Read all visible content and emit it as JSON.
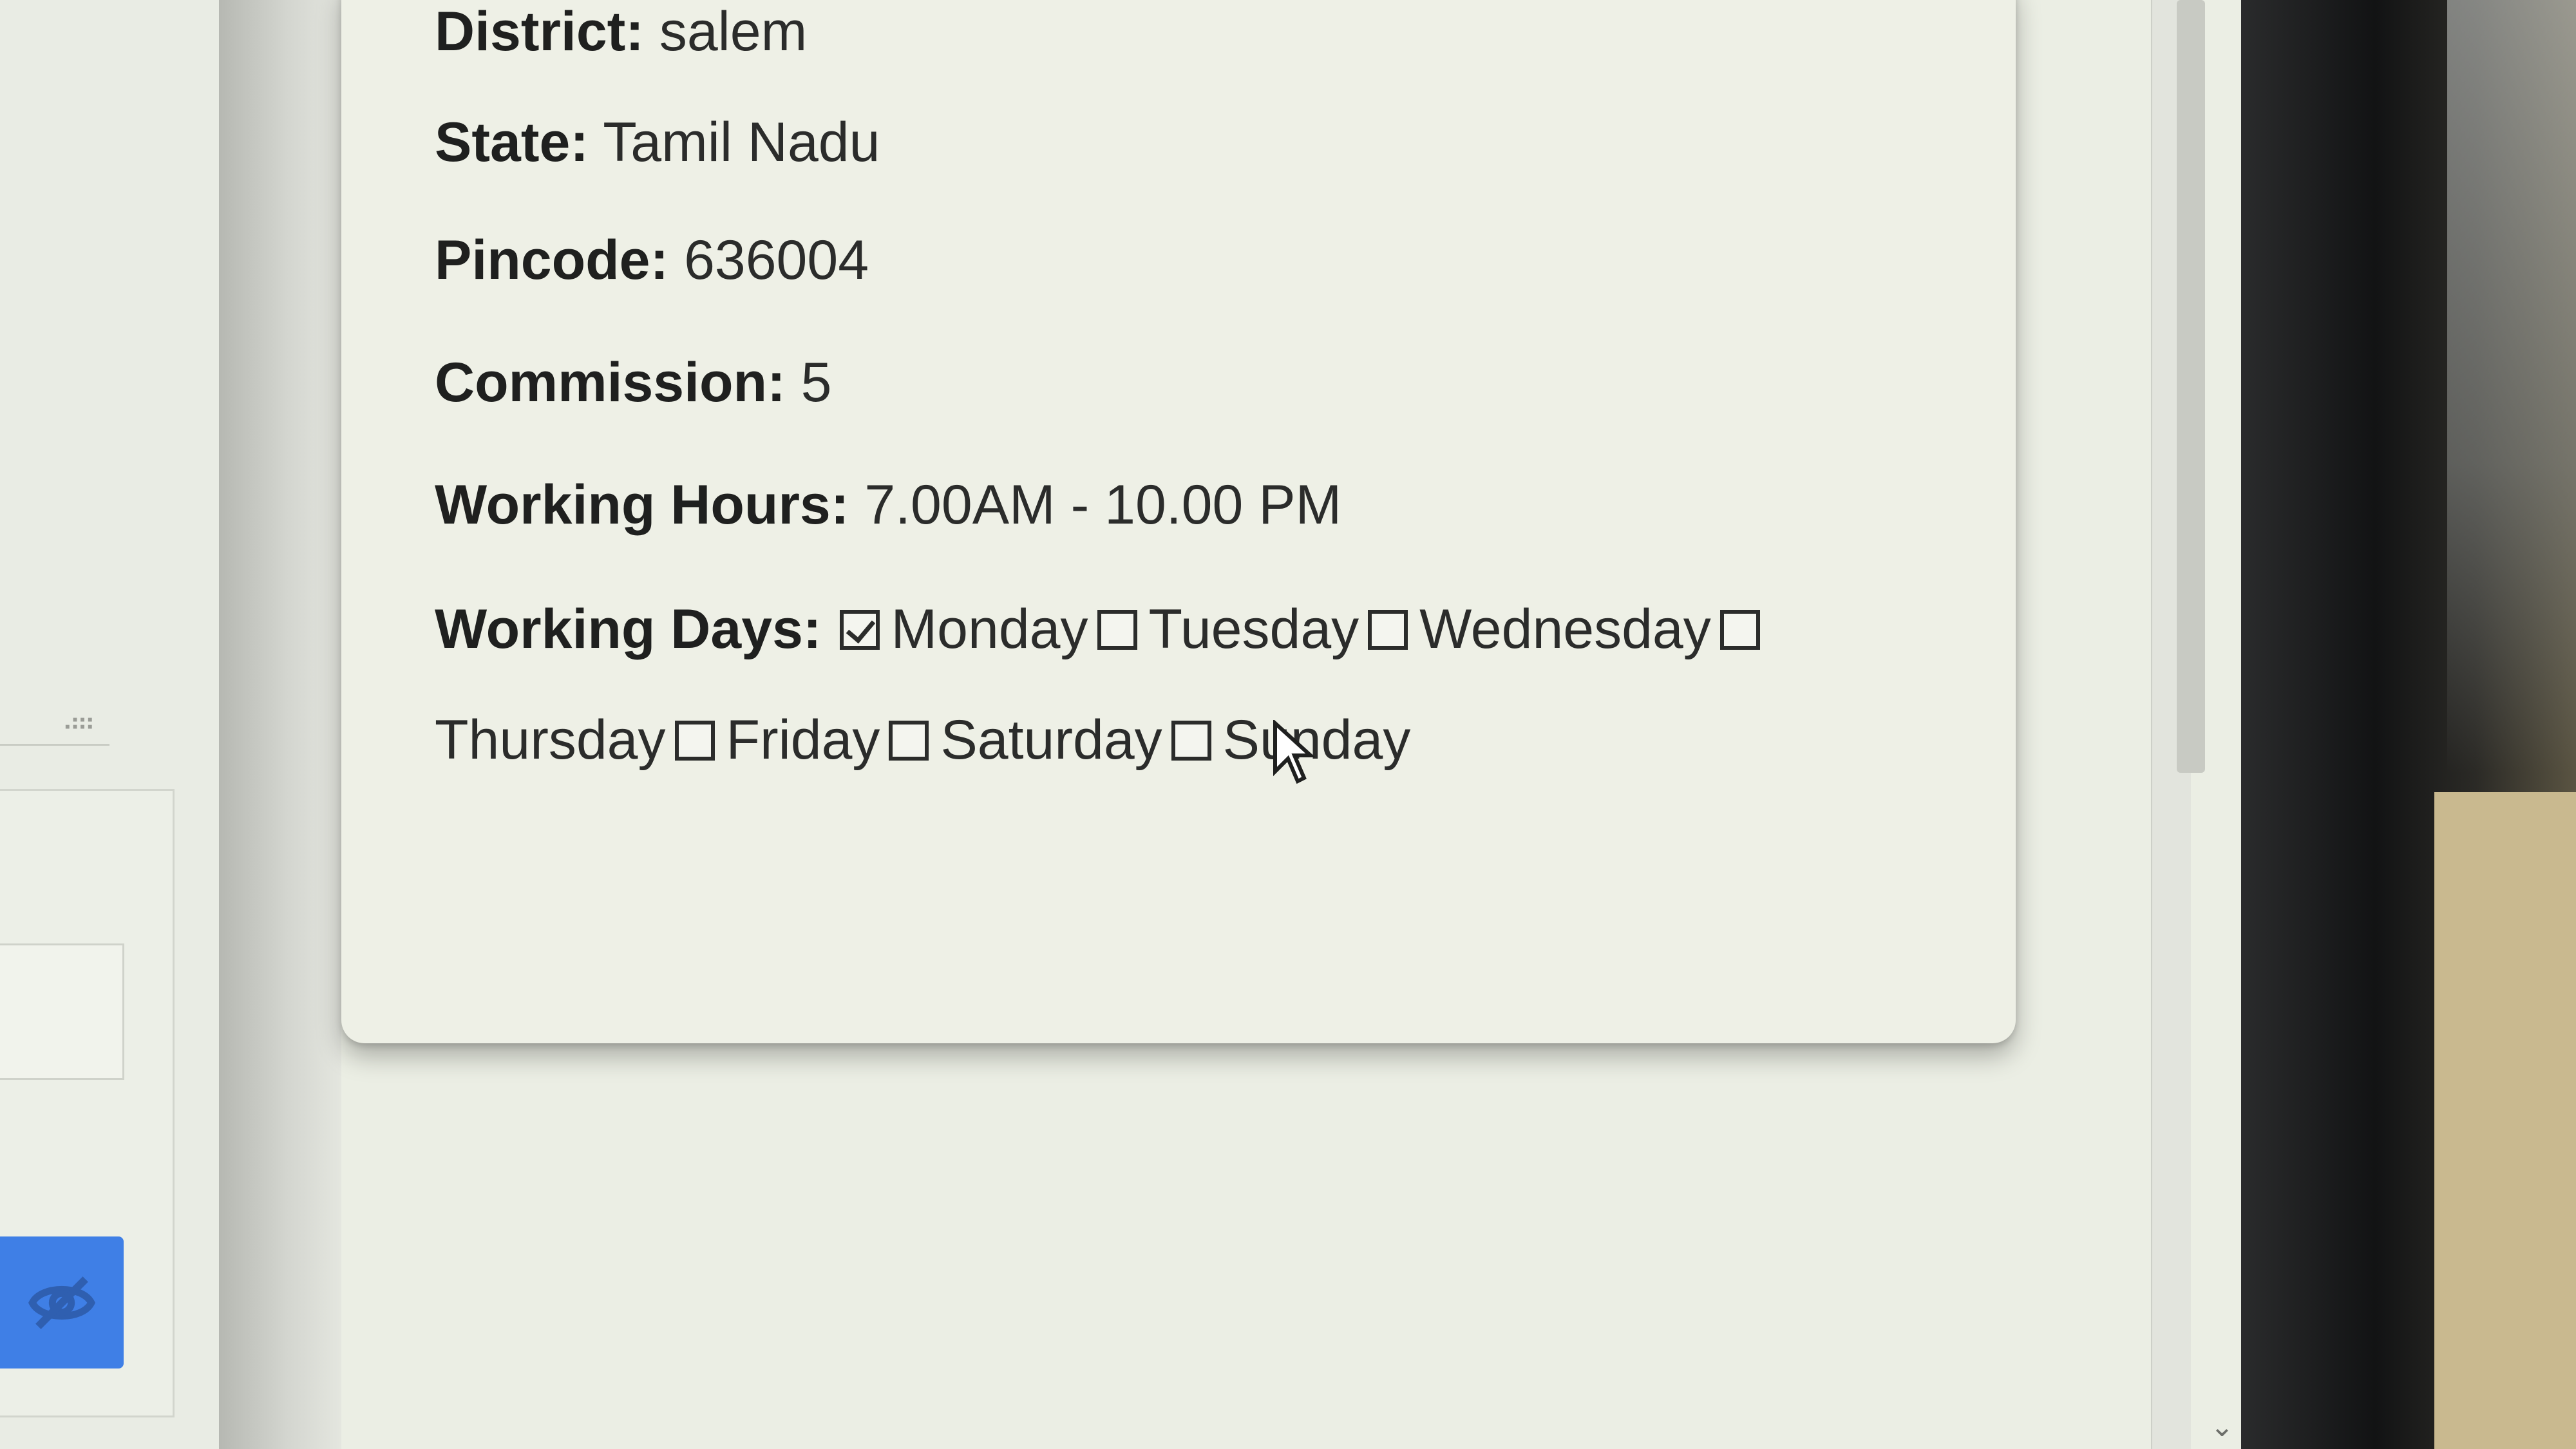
{
  "details": {
    "district": {
      "label": "District:",
      "value": "salem"
    },
    "state": {
      "label": "State:",
      "value": "Tamil Nadu"
    },
    "pincode": {
      "label": "Pincode:",
      "value": "636004"
    },
    "commission": {
      "label": "Commission:",
      "value": "5"
    },
    "working_hours": {
      "label": "Working Hours:",
      "value": "7.00AM - 10.00 PM"
    },
    "working_days": {
      "label": "Working Days:",
      "days": [
        {
          "name": "Monday",
          "checked": true
        },
        {
          "name": "Tuesday",
          "checked": false
        },
        {
          "name": "Wednesday",
          "checked": false
        },
        {
          "name": "Thursday",
          "checked": false
        },
        {
          "name": "Friday",
          "checked": false
        },
        {
          "name": "Saturday",
          "checked": false
        },
        {
          "name": "Sunday",
          "checked": false
        }
      ]
    }
  },
  "icons": {
    "eye_toggle": "eye-off-icon",
    "resize_grip": "resize-grip-icon",
    "cursor": "mouse-pointer-icon",
    "scroll_down": "chevron-down-icon"
  },
  "colors": {
    "accent": "#3f7fe6",
    "card_bg": "#eef0e6"
  }
}
